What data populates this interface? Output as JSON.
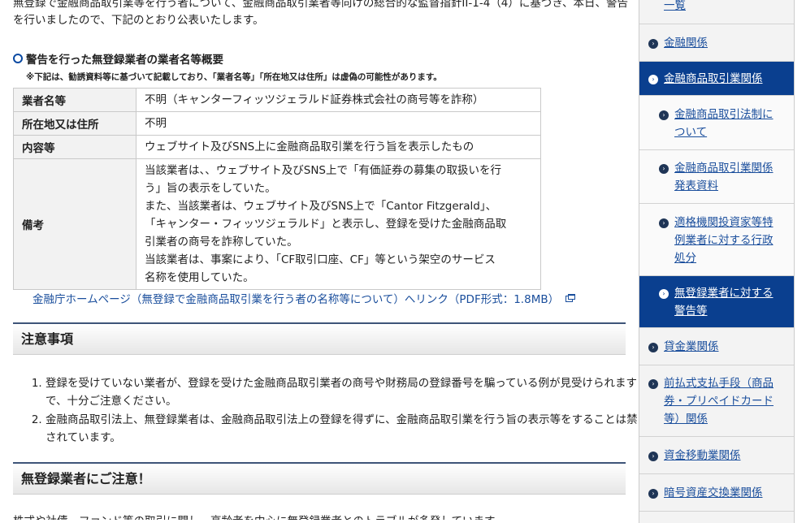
{
  "intro_text": "無登録で金融商品取引業等を行う者について、金融商品取引業者等向けの総合的な監督指針II-1-4（4）に基づき、本日、警告を行いましたので、下記のとおり公表いたします。",
  "section_title": "警告を行った無登録業者の業者名等概要",
  "section_note": "※下記は、勧誘資料等に基づいて記載しており、「業者名等」「所在地又は住所」は虚偽の可能性があります。",
  "table": {
    "rows": [
      {
        "label": "業者名等",
        "lines": [
          "不明（キャンターフィッツジェラルド証券株式会社の商号等を詐称）"
        ]
      },
      {
        "label": "所在地又は住所",
        "lines": [
          "不明"
        ]
      },
      {
        "label": "内容等",
        "lines": [
          "ウェブサイト及びSNS上に金融商品取引業を行う旨を表示したもの"
        ]
      },
      {
        "label": "備考",
        "lines": [
          "当該業者は、、ウェブサイト及びSNS上で「有価証券の募集の取扱いを行",
          "う」旨の表示をしていた。",
          "また、当該業者は、ウェブサイト及びSNS上で「Cantor Fitzgerald」、",
          "「キャンター・フィッツジェラルド」と表示し、登録を受けた金融商品取",
          "引業者の商号を詐称していた。",
          "当該業者は、事案により、「CF取引口座、CF」等という架空のサービス",
          "名称を使用していた。"
        ]
      }
    ]
  },
  "external_link": "金融庁ホームページ（無登録で金融商品取引業を行う者の名称等について）へリンク（PDF形式：1.8MB）",
  "caution": {
    "title": "注意事項",
    "items": [
      "登録を受けていない業者が、登録を受けた金融商品取引業者の商号や財務局の登録番号を騙っている例が見受けられますので、十分ご注意ください。",
      "金融商品取引法上、無登録業者は、金融商品取引法上の登録を得ずに、金融商品取引業を行う旨の表示等をすることは禁止されています。"
    ]
  },
  "warning": {
    "title": "無登録業者にご注意！",
    "text": "株式や社債、ファンド等の取引に関し、高齢者を中心に無登録業者とのトラブルが多発しています。"
  },
  "sidebar": {
    "items": [
      {
        "lines": [
          "一覧"
        ],
        "level": 0,
        "active": false
      },
      {
        "lines": [
          "金融関係"
        ],
        "level": 0,
        "active": false
      },
      {
        "lines": [
          "金融商品取引業関係"
        ],
        "level": 0,
        "active": true
      },
      {
        "lines": [
          "金融商品取引法制に",
          "ついて"
        ],
        "level": 1,
        "active": false
      },
      {
        "lines": [
          "金融商品取引業関係",
          "発表資料"
        ],
        "level": 1,
        "active": false
      },
      {
        "lines": [
          "適格機関投資家等特",
          "例業者に対する行政",
          "処分"
        ],
        "level": 1,
        "active": false
      },
      {
        "lines": [
          "無登録業者に対する",
          "警告等"
        ],
        "level": 1,
        "active": true
      },
      {
        "lines": [
          "貸金業関係"
        ],
        "level": 0,
        "active": false
      },
      {
        "lines": [
          "前払式支払手段（商品",
          "券・プリペイドカード",
          "等）関係"
        ],
        "level": 0,
        "active": false
      },
      {
        "lines": [
          "資金移動業関係"
        ],
        "level": 0,
        "active": false
      },
      {
        "lines": [
          "暗号資産交換業関係"
        ],
        "level": 0,
        "active": false
      }
    ]
  }
}
